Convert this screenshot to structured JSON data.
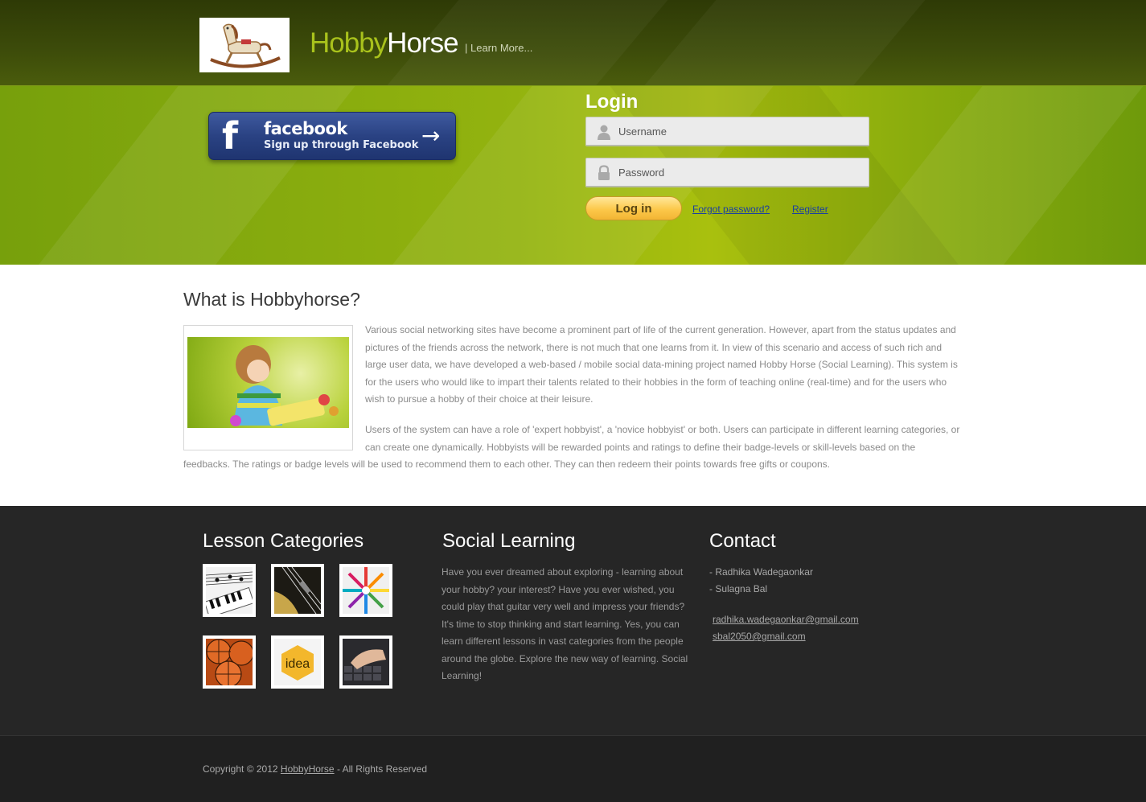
{
  "header": {
    "brand_part1": "Hobby",
    "brand_part2": "Horse",
    "learn_more": "| Learn More..."
  },
  "facebook": {
    "icon_letter": "f",
    "title": "facebook",
    "subtitle": "Sign up through Facebook",
    "arrow": "→"
  },
  "login": {
    "title": "Login",
    "username_placeholder": "Username",
    "password_placeholder": "Password",
    "button_label": "Log in",
    "forgot_label": "Forgot password?",
    "register_label": "Register"
  },
  "about": {
    "heading": "What is Hobbyhorse?",
    "paragraph1": "Various social networking sites have become a prominent part of life of the current generation. However, apart from the status updates and pictures of the friends across the network, there is not much that one learns from it. In view of this scenario and access of such rich and large user data, we have developed a web-based / mobile social data-mining project named Hobby Horse (Social Learning). This system is for the users who would like to impart their talents related to their hobbies in the form of teaching online (real-time) and for the users who wish to pursue a hobby of their choice at their leisure.",
    "paragraph2": "Users of the system can have a role of 'expert hobbyist', a 'novice hobbyist' or both. Users can participate in different learning categories, or can create one dynamically. Hobbyists will be rewarded points and ratings to define their badge-levels or skill-levels based on the",
    "paragraph3": "feedbacks. The ratings or badge levels will be used to recommend them to each other. They can then redeem their points towards free gifts or coupons."
  },
  "footer": {
    "lesson_heading": "Lesson Categories",
    "lesson_thumbs": [
      "music-icon",
      "guitar-icon",
      "pencils-icon",
      "basketball-icon",
      "idea-icon",
      "keyboard-icon"
    ],
    "idea_text": "idea",
    "social_heading": "Social Learning",
    "social_text": "Have you ever dreamed about exploring - learning about your hobby? your interest? Have you ever wished, you could play that guitar very well and impress your friends?",
    "social_text2": "It's time to stop thinking and start learning. Yes, you can learn different lessons in vast categories from the people around the globe. Explore the new way of learning. Social Learning!",
    "contact_heading": "Contact",
    "contact_names": [
      "- Radhika Wadegaonkar",
      "- Sulagna Bal"
    ],
    "contact_emails": [
      "radhika.wadegaonkar@gmail.com",
      "sbal2050@gmail.com"
    ]
  },
  "copyright": {
    "prefix": "Copyright © 2012 ",
    "link": "HobbyHorse",
    "suffix": " - All Rights Reserved"
  },
  "colors": {
    "brand_green": "#a9c21c",
    "facebook_blue": "#2a4283",
    "login_button": "#fcc84a",
    "link_blue": "#1b3fa0",
    "footer_bg": "#262626"
  }
}
